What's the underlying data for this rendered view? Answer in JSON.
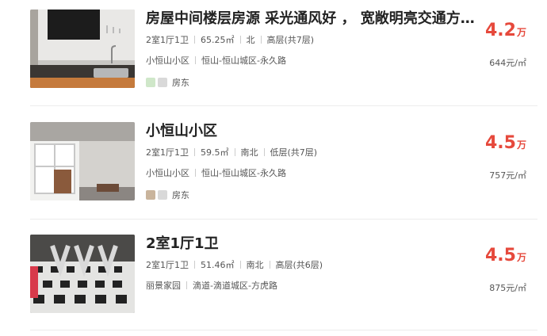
{
  "listings": [
    {
      "title": "房屋中间楼层房源 采光通风好 ， 宽敞明亮交通方…",
      "layout": "2室1厅1卫",
      "area": "65.25㎡",
      "orientation": "北",
      "floor": "高层(共7层)",
      "community": "小恒山小区",
      "district": "恒山-恒山城区-永久路",
      "agent": "房东",
      "price": "4.2",
      "price_unit": "万",
      "unit_price": "644元/㎡"
    },
    {
      "title": "小恒山小区",
      "layout": "2室1厅1卫",
      "area": "59.5㎡",
      "orientation": "南北",
      "floor": "低层(共7层)",
      "community": "小恒山小区",
      "district": "恒山-恒山城区-永久路",
      "agent": "房东",
      "price": "4.5",
      "price_unit": "万",
      "unit_price": "757元/㎡"
    },
    {
      "title": "2室1厅1卫",
      "layout": "2室1厅1卫",
      "area": "51.46㎡",
      "orientation": "南北",
      "floor": "高层(共6层)",
      "community": "丽景家园",
      "district": "滴道-滴道城区-方虎路",
      "price": "4.5",
      "price_unit": "万",
      "unit_price": "875元/㎡"
    }
  ]
}
